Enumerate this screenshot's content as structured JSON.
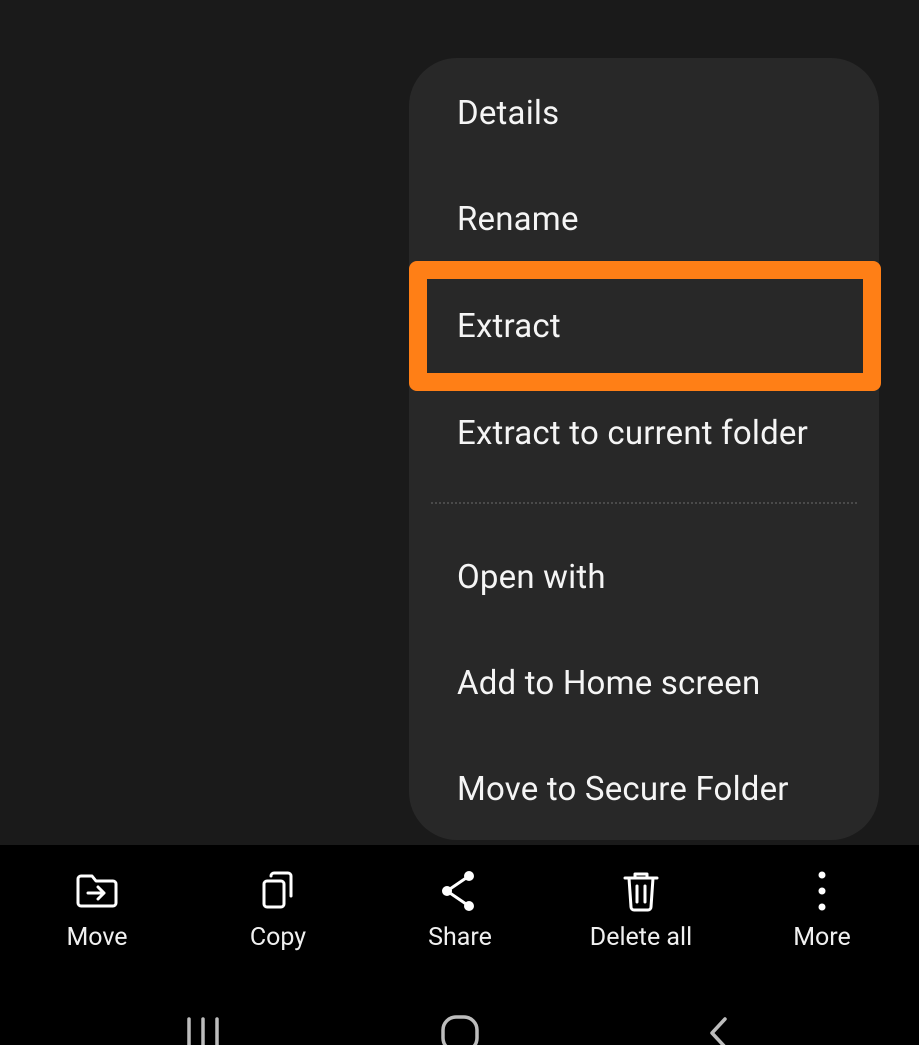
{
  "menu": {
    "items": [
      {
        "label": "Details"
      },
      {
        "label": "Rename"
      },
      {
        "label": "Extract"
      },
      {
        "label": "Extract to current folder"
      },
      {
        "label": "Open with"
      },
      {
        "label": "Add to Home screen"
      },
      {
        "label": "Move to Secure Folder"
      }
    ],
    "highlighted_item": "Extract"
  },
  "colors": {
    "background": "#1a1a1a",
    "menu_bg": "#282828",
    "highlight": "#ff7f16",
    "bottom_bar": "#000000"
  },
  "bottom_bar": {
    "actions": [
      {
        "label": "Move",
        "icon": "move-to-folder-icon"
      },
      {
        "label": "Copy",
        "icon": "copy-icon"
      },
      {
        "label": "Share",
        "icon": "share-icon"
      },
      {
        "label": "Delete all",
        "icon": "trash-icon"
      },
      {
        "label": "More",
        "icon": "more-vertical-icon"
      }
    ]
  },
  "nav_bar": {
    "buttons": [
      {
        "icon": "recent-apps-icon"
      },
      {
        "icon": "home-icon"
      },
      {
        "icon": "back-icon"
      }
    ]
  }
}
